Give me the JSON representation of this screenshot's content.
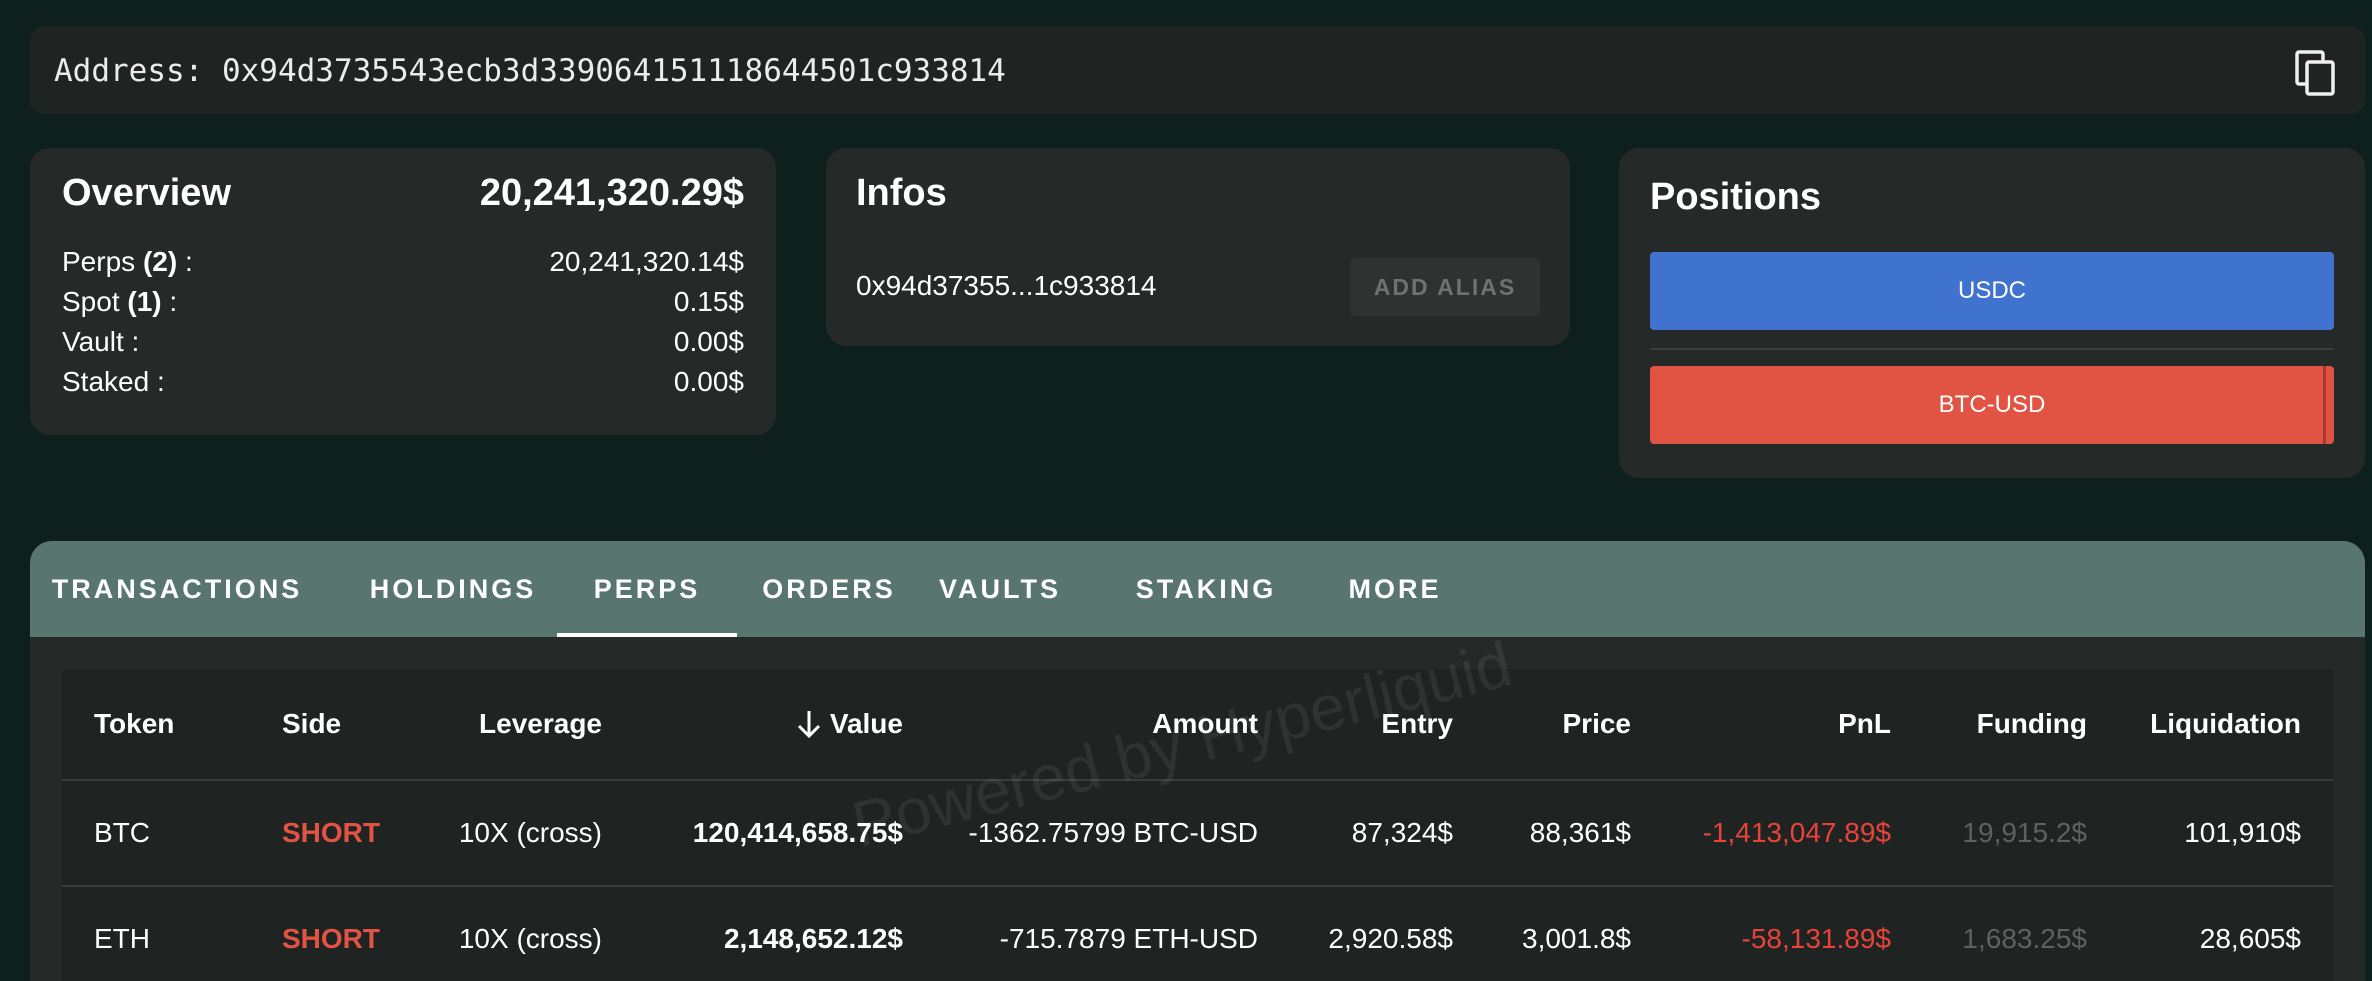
{
  "address_bar": {
    "label": "Address: 0x94d3735543ecb3d339064151118644501c933814",
    "copy_icon": "copy-icon"
  },
  "overview": {
    "title": "Overview",
    "total": "20,241,320.29$",
    "rows": [
      {
        "label": "Perps",
        "count": "(2)",
        "suffix": " :",
        "value": "20,241,320.14$"
      },
      {
        "label": "Spot",
        "count": "(1)",
        "suffix": " :",
        "value": "0.15$"
      },
      {
        "label": "Vault :",
        "count": "",
        "suffix": "",
        "value": "0.00$"
      },
      {
        "label": "Staked :",
        "count": "",
        "suffix": "",
        "value": "0.00$"
      }
    ]
  },
  "infos": {
    "title": "Infos",
    "short_address": "0x94d37355...1c933814",
    "add_alias_label": "ADD ALIAS"
  },
  "positions": {
    "title": "Positions",
    "bars": [
      {
        "label": "USDC",
        "color": "#3f73ce"
      },
      {
        "label": "BTC-USD",
        "color": "#e15443"
      }
    ]
  },
  "tabs": [
    {
      "label": "TRANSACTIONS",
      "active": false
    },
    {
      "label": "HOLDINGS",
      "active": false
    },
    {
      "label": "PERPS",
      "active": true
    },
    {
      "label": "ORDERS",
      "active": false
    },
    {
      "label": "VAULTS",
      "active": false
    },
    {
      "label": "STAKING",
      "active": false
    },
    {
      "label": "MORE",
      "active": false
    }
  ],
  "table": {
    "headers": [
      "Token",
      "Side",
      "Leverage",
      "Value",
      "Amount",
      "Entry",
      "Price",
      "PnL",
      "Funding",
      "Liquidation"
    ],
    "sort_icon": "arrow-down-icon",
    "rows": [
      {
        "token": "BTC",
        "side": "SHORT",
        "leverage": "10X (cross)",
        "value": "120,414,658.75$",
        "amount": "-1362.75799 BTC-USD",
        "entry": "87,324$",
        "price": "88,361$",
        "pnl": "-1,413,047.89$",
        "funding": "19,915.2$",
        "liquidation": "101,910$"
      },
      {
        "token": "ETH",
        "side": "SHORT",
        "leverage": "10X (cross)",
        "value": "2,148,652.12$",
        "amount": "-715.7879 ETH-USD",
        "entry": "2,920.58$",
        "price": "3,001.8$",
        "pnl": "-58,131.89$",
        "funding": "1,683.25$",
        "liquidation": "28,605$"
      }
    ]
  },
  "watermark": "Powered by Hyperliquid",
  "colors": {
    "background": "#0d201d",
    "card": "#252a29",
    "tabbar": "#587570",
    "short": "#e15443",
    "usdc": "#3f73ce"
  }
}
